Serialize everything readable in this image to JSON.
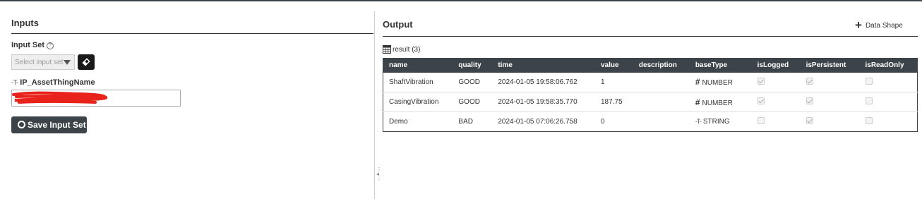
{
  "inputs": {
    "title": "Inputs",
    "input_set_label": "Input Set",
    "help_icon": "?",
    "select_placeholder": "Select input set",
    "param_name": "IP_AssetThingName",
    "param_value": "",
    "save_button": "Save Input Set"
  },
  "output": {
    "title": "Output",
    "data_shape_button": "Data Shape",
    "result_label": "result (3)",
    "columns": [
      "name",
      "quality",
      "time",
      "value",
      "description",
      "baseType",
      "isLogged",
      "isPersistent",
      "isReadOnly"
    ],
    "rows": [
      {
        "name": "ShaftVibration",
        "quality": "GOOD",
        "time": "2024-01-05 19:58:06.762",
        "value": "1",
        "description": "",
        "baseType": "NUMBER",
        "baseTypeIcon": "hash-icon",
        "isLogged": true,
        "isPersistent": true,
        "isReadOnly": false
      },
      {
        "name": "CasingVibration",
        "quality": "GOOD",
        "time": "2024-01-05 19:58:35.770",
        "value": "187.75",
        "description": "",
        "baseType": "NUMBER",
        "baseTypeIcon": "hash-icon",
        "isLogged": true,
        "isPersistent": true,
        "isReadOnly": false
      },
      {
        "name": "Demo",
        "quality": "BAD",
        "time": "2024-01-05 07:06:26.758",
        "value": "0",
        "description": "",
        "baseType": "STRING",
        "baseTypeIcon": "string-icon",
        "isLogged": false,
        "isPersistent": true,
        "isReadOnly": false
      }
    ]
  },
  "colors": {
    "header_bg": "#3d4449",
    "button_bg": "#3d4449",
    "redaction": "#e8231b"
  }
}
